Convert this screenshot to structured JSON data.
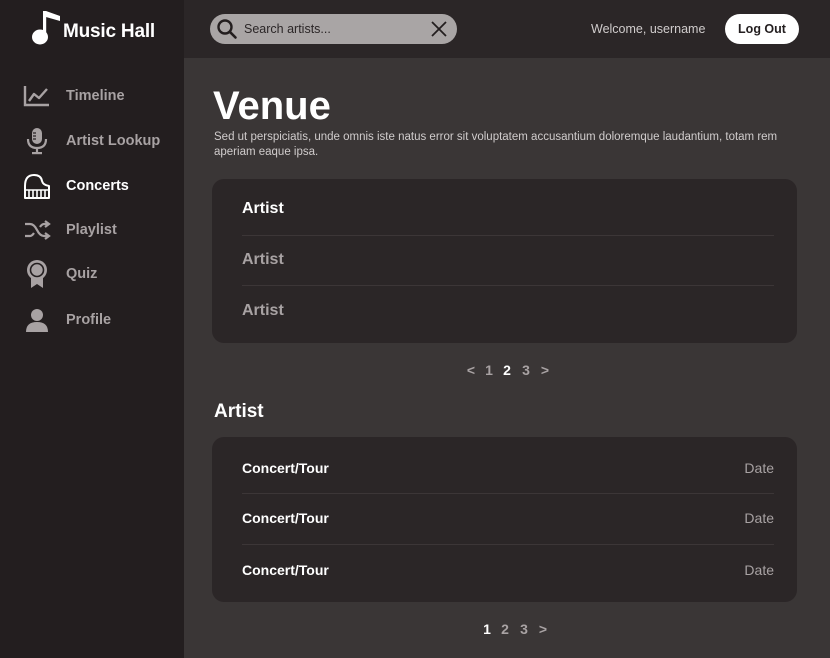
{
  "app": {
    "name": "Music Hall"
  },
  "sidebar": {
    "items": [
      {
        "label": "Timeline",
        "icon": "chart-line-icon"
      },
      {
        "label": "Artist Lookup",
        "icon": "microphone-icon"
      },
      {
        "label": "Concerts",
        "icon": "piano-icon",
        "active": true
      },
      {
        "label": "Playlist",
        "icon": "shuffle-icon"
      },
      {
        "label": "Quiz",
        "icon": "award-ribbon-icon"
      },
      {
        "label": "Profile",
        "icon": "user-icon"
      }
    ]
  },
  "header": {
    "search": {
      "placeholder": "Search artists..."
    },
    "welcome_text": "Welcome, username",
    "logout_label": "Log Out"
  },
  "main": {
    "title": "Venue",
    "description": "Sed ut perspiciatis, unde omnis iste natus error sit voluptatem accusantium doloremque laudantium, totam rem aperiam eaque ipsa.",
    "artists": [
      "Artist",
      "Artist",
      "Artist"
    ],
    "artists_pager": {
      "prev": "<",
      "pages": [
        "1",
        "2",
        "3"
      ],
      "current": "2",
      "next": ">"
    },
    "section_title": "Artist",
    "concerts": [
      {
        "name": "Concert/Tour",
        "date": "Date"
      },
      {
        "name": "Concert/Tour",
        "date": "Date"
      },
      {
        "name": "Concert/Tour",
        "date": "Date"
      }
    ],
    "concerts_pager": {
      "pages": [
        "1",
        "2",
        "3"
      ],
      "current": "1",
      "next": ">"
    }
  },
  "colors": {
    "sidebar_bg": "#231e1f",
    "main_bg": "#3a3636",
    "card_bg": "#2b2627",
    "muted_text": "#a8a2a3",
    "search_bg": "#a9a5a5"
  }
}
